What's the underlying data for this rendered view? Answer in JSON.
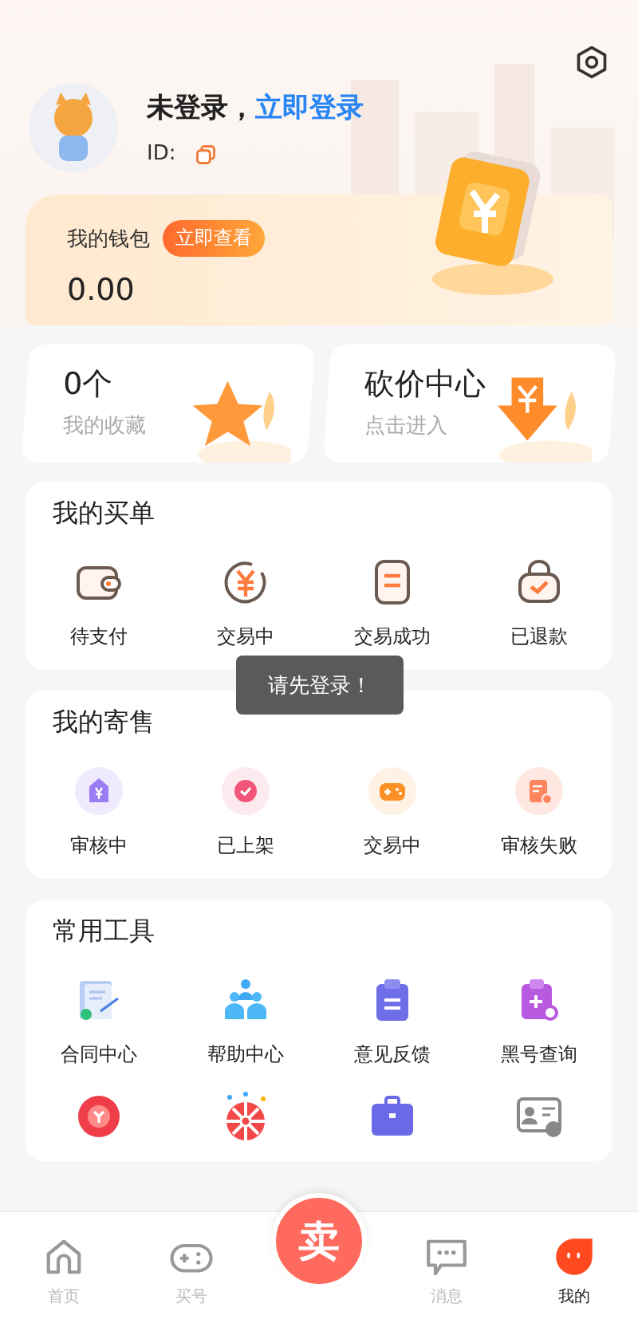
{
  "header": {
    "status": "未登录，",
    "login_link": "立即登录",
    "id_label": "ID:"
  },
  "wallet": {
    "title": "我的钱包",
    "button": "立即查看",
    "balance": "0.00"
  },
  "quick_cards": [
    {
      "title": "0个",
      "subtitle": "我的收藏",
      "kind": "star"
    },
    {
      "title": "砍价中心",
      "subtitle": "点击进入",
      "kind": "price-down"
    }
  ],
  "buy_orders": {
    "title": "我的买单",
    "items": [
      {
        "label": "待支付",
        "kind": "wallet"
      },
      {
        "label": "交易中",
        "kind": "yuan-cycle"
      },
      {
        "label": "交易成功",
        "kind": "document"
      },
      {
        "label": "已退款",
        "kind": "bag-check"
      }
    ]
  },
  "consignment": {
    "title": "我的寄售",
    "items": [
      {
        "label": "审核中",
        "kind": "house-yuan"
      },
      {
        "label": "已上架",
        "kind": "badge-check"
      },
      {
        "label": "交易中",
        "kind": "gamepad"
      },
      {
        "label": "审核失败",
        "kind": "form-gear"
      }
    ]
  },
  "tools": {
    "title": "常用工具",
    "items": [
      {
        "label": "合同中心",
        "kind": "contract"
      },
      {
        "label": "帮助中心",
        "kind": "people"
      },
      {
        "label": "意见反馈",
        "kind": "clipboard"
      },
      {
        "label": "黑号查询",
        "kind": "clipboard-search"
      },
      {
        "kind": "exchange"
      },
      {
        "kind": "wheel"
      },
      {
        "kind": "briefcase"
      },
      {
        "kind": "id-card"
      }
    ]
  },
  "toast": "请先登录！",
  "tab_bar": [
    {
      "label": "首页",
      "kind": "home",
      "selected": false
    },
    {
      "label": "买号",
      "kind": "gamepad",
      "selected": false
    },
    {
      "label": "卖",
      "kind": "sell",
      "selected": false
    },
    {
      "label": "消息",
      "kind": "message",
      "selected": false
    },
    {
      "label": "我的",
      "kind": "mine",
      "selected": true
    }
  ]
}
